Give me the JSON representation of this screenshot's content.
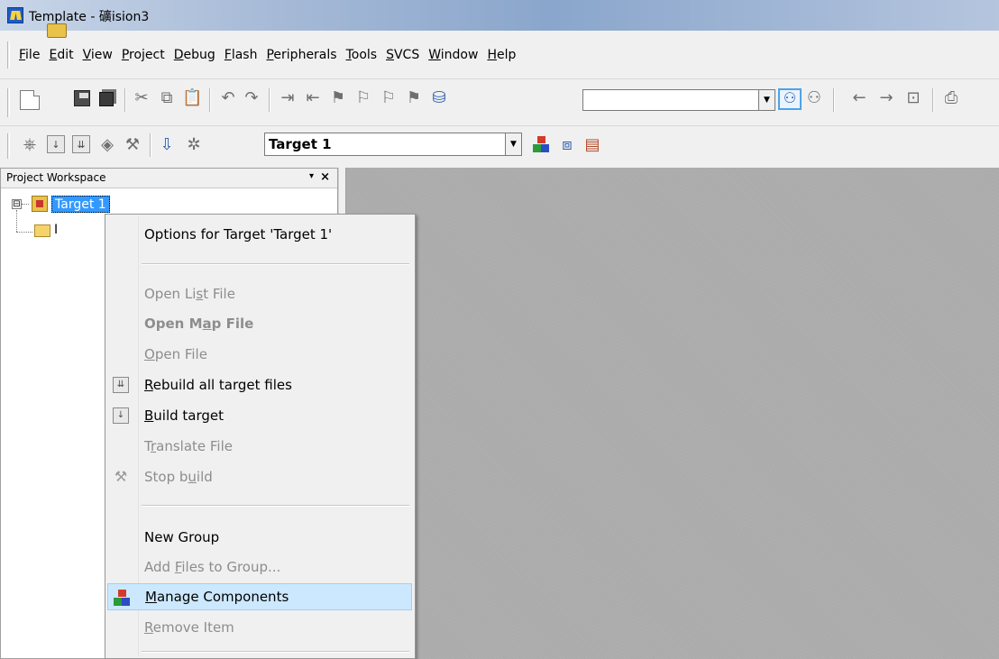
{
  "window": {
    "title": "Template  - 礦ision3"
  },
  "menubar": {
    "items": [
      "File",
      "Edit",
      "View",
      "Project",
      "Debug",
      "Flash",
      "Peripherals",
      "Tools",
      "SVCS",
      "Window",
      "Help"
    ]
  },
  "toolbar1": {
    "icons": [
      "new-file-icon",
      "open-folder-icon",
      "save-icon",
      "save-all-icon",
      "cut-icon",
      "copy-icon",
      "paste-icon",
      "undo-icon",
      "redo-icon",
      "indent-icon",
      "unindent-icon",
      "bookmark-icon",
      "next-bookmark-icon",
      "prev-bookmark-icon",
      "clear-bookmarks-icon",
      "find-in-files-icon",
      "find-icon",
      "incremental-find-icon",
      "nav-back-icon",
      "nav-forward-icon",
      "source-browser-icon",
      "print-icon"
    ],
    "find_value": ""
  },
  "toolbar2": {
    "icons": [
      "translate-icon",
      "build-icon",
      "rebuild-icon",
      "batch-build-icon",
      "stop-build-icon",
      "download-icon",
      "target-options-icon",
      "manage-components-icon",
      "select-packs-icon",
      "books-icon"
    ],
    "target_combo": "Target 1"
  },
  "workspace": {
    "title": "Project Workspace",
    "pin_glyph": "▾",
    "close_glyph": "×",
    "tree": {
      "expander_glyph": "⊟",
      "target_label": "Target 1",
      "group_label": "I"
    }
  },
  "context_menu": {
    "options_target": "Options for Target 'Target 1'",
    "open_list_file": {
      "pre": "Open Li",
      "ul": "s",
      "post": "t File"
    },
    "open_map_file": {
      "pre": "Open M",
      "ul": "a",
      "post": "p File"
    },
    "open_file": {
      "pre": "",
      "ul": "O",
      "post": "pen File"
    },
    "rebuild_all": {
      "pre": "",
      "ul": "R",
      "post": "ebuild all target files"
    },
    "build_target": {
      "pre": "",
      "ul": "B",
      "post": "uild target"
    },
    "translate_file": {
      "pre": "T",
      "ul": "r",
      "post": "anslate File"
    },
    "stop_build": {
      "pre": "Stop b",
      "ul": "u",
      "post": "ild"
    },
    "new_group": "New Group",
    "add_files": {
      "pre": "Add ",
      "ul": "F",
      "post": "iles to Group..."
    },
    "manage_components": {
      "pre": "",
      "ul": "M",
      "post": "anage Components"
    },
    "remove_item": {
      "pre": "",
      "ul": "R",
      "post": "emove Item"
    },
    "icons": {
      "rebuild": "rebuild-icon",
      "build": "build-icon",
      "stop": "stop-build-icon",
      "manage": "manage-components-icon"
    }
  },
  "colors": {
    "selection": "#3399ff",
    "menu_hover": "#cce8ff",
    "mdi_background": "#ababab",
    "disabled_text": "#8d8d8d"
  }
}
